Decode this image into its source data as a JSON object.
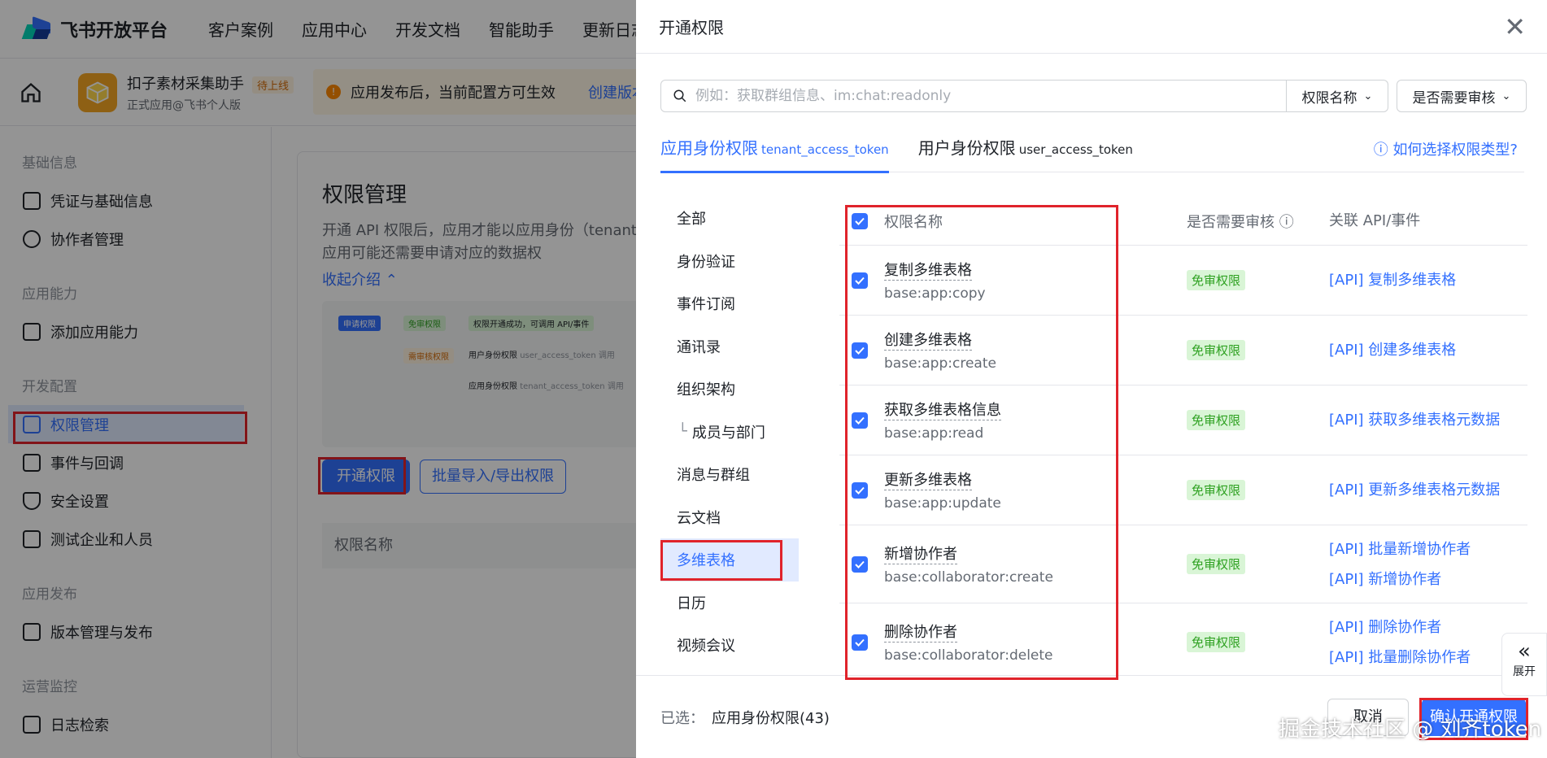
{
  "topbar": {
    "logo_text": "飞书开放平台",
    "nav": [
      "客户案例",
      "应用中心",
      "开发文档",
      "智能助手",
      "更新日志"
    ]
  },
  "app": {
    "name": "扣子素材采集助手",
    "tag": "待上线",
    "subtitle": "正式应用@飞书个人版"
  },
  "notice": {
    "text": "应用发布后，当前配置方可生效",
    "link": "创建版本"
  },
  "sidebar": {
    "groups": [
      {
        "title": "基础信息",
        "items": [
          "凭证与基础信息",
          "协作者管理"
        ]
      },
      {
        "title": "应用能力",
        "items": [
          "添加应用能力"
        ]
      },
      {
        "title": "开发配置",
        "items": [
          "权限管理",
          "事件与回调",
          "安全设置",
          "测试企业和人员"
        ]
      },
      {
        "title": "应用发布",
        "items": [
          "版本管理与发布"
        ]
      },
      {
        "title": "运营监控",
        "items": [
          "日志检索"
        ]
      }
    ]
  },
  "main": {
    "title": "权限管理",
    "desc": "开通 API 权限后，应用才能以应用身份（tenant_a 用飞书 API 时，应用可能还需要申请对应的数据权",
    "collapse": "收起介绍",
    "btn_open": "开通权限",
    "btn_batch": "批量导入/导出权限",
    "table_col": "权限名称"
  },
  "diagram": {
    "a": "申请权限",
    "b": "免审权限",
    "c": "权限开通成功，可调用 API/事件",
    "d": "需审核权限",
    "e": "用户身份权限",
    "e2": "user_access_token 调用",
    "f": "应用身份权限",
    "f2": "tenant_access_token 调用"
  },
  "drawer": {
    "title": "开通权限",
    "search_placeholder": "例如：获取群组信息、im:chat:readonly",
    "select1": "权限名称",
    "select2": "是否需要审核",
    "tabs": [
      {
        "label": "应用身份权限",
        "sub": "tenant_access_token"
      },
      {
        "label": "用户身份权限",
        "sub": "user_access_token"
      }
    ],
    "help": "如何选择权限类型?",
    "categories": [
      "全部",
      "身份验证",
      "事件订阅",
      "通讯录",
      "组织架构",
      "成员与部门",
      "消息与群组",
      "云文档",
      "多维表格",
      "日历",
      "视频会议"
    ],
    "head": {
      "name": "权限名称",
      "review": "是否需要审核",
      "api": "关联 API/事件"
    },
    "rows": [
      {
        "title": "复制多维表格",
        "key": "base:app:copy",
        "review": "免审权限",
        "api": [
          "[API] 复制多维表格"
        ]
      },
      {
        "title": "创建多维表格",
        "key": "base:app:create",
        "review": "免审权限",
        "api": [
          "[API] 创建多维表格"
        ]
      },
      {
        "title": "获取多维表格信息",
        "key": "base:app:read",
        "review": "免审权限",
        "api": [
          "[API] 获取多维表格元数据"
        ]
      },
      {
        "title": "更新多维表格",
        "key": "base:app:update",
        "review": "免审权限",
        "api": [
          "[API] 更新多维表格元数据"
        ]
      },
      {
        "title": "新增协作者",
        "key": "base:collaborator:create",
        "review": "免审权限",
        "api": [
          "[API] 批量新增协作者",
          "[API] 新增协作者"
        ]
      },
      {
        "title": "删除协作者",
        "key": "base:collaborator:delete",
        "review": "免审权限",
        "api": [
          "[API] 删除协作者",
          "[API] 批量删除协作者"
        ]
      }
    ],
    "footer": {
      "selected_label": "已选：",
      "selected_value": "应用身份权限(43)",
      "cancel": "取消",
      "confirm": "确认开通权限"
    },
    "expand": "展开"
  },
  "watermark": "掘金技术社区 @ 刘齐token"
}
